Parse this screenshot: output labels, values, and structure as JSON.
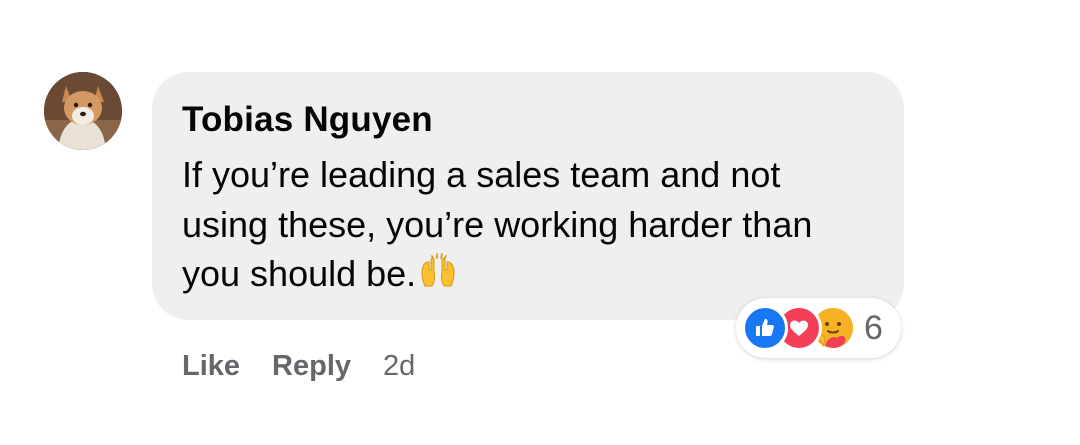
{
  "comment": {
    "author": "Tobias Nguyen",
    "text": "If you’re leading a sales team and not using these, you’re working harder than you should be.",
    "inline_emoji": "raising-hands",
    "avatar_icon": "dog-avatar"
  },
  "reactions": {
    "types": [
      "like",
      "love",
      "care"
    ],
    "count": "6",
    "colors": {
      "like": "#1877f2",
      "love": "#f33e58",
      "care": "#f7b125"
    }
  },
  "actions": {
    "like_label": "Like",
    "reply_label": "Reply",
    "timestamp": "2d"
  },
  "colors": {
    "bubble": "#efefef",
    "meta_text": "#65676b",
    "text": "#050505"
  }
}
